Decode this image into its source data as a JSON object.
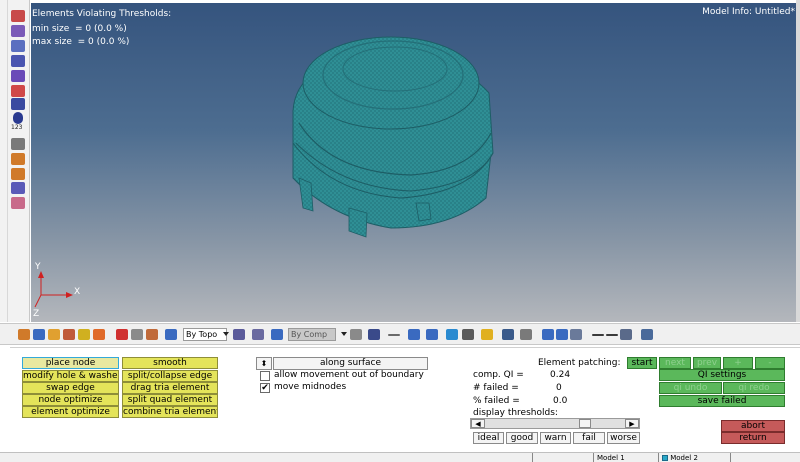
{
  "viewport": {
    "title": "Elements Violating Thresholds:",
    "min_size": "min size  = 0 (0.0 %)",
    "max_size": "max size  = 0 (0.0 %)",
    "model_info": "Model Info: Untitled*",
    "axis_x": "X",
    "axis_y": "Y",
    "axis_z": "Z"
  },
  "toolbar": {
    "by_topo": "By Topo",
    "by_comp": "By Comp"
  },
  "left_buttons": [
    "place node",
    "modify hole & washers",
    "swap edge",
    "node optimize",
    "element optimize"
  ],
  "right_buttons": [
    "smooth",
    "split/collapse edge",
    "drag tria element",
    "split quad element",
    "combine tria elements"
  ],
  "middle": {
    "along_surface": "along surface",
    "allow_movement": "allow movement out of boundary",
    "move_midnodes": "move midnodes",
    "move_midnodes_checked": "✔"
  },
  "stats": {
    "patching_label": "Element patching:",
    "comp_qi_label": "comp. QI =",
    "comp_qi_value": "0.24",
    "failed_label": "# failed =",
    "failed_value": "0",
    "pct_failed_label": "% failed =",
    "pct_failed_value": "0.0",
    "display_thresholds": "display thresholds:"
  },
  "thresholds": [
    "ideal",
    "good",
    "warn",
    "fail",
    "worse"
  ],
  "nav": {
    "start": "start",
    "next": "next",
    "prev": "prev",
    "plus": "+",
    "minus": "-",
    "qi_settings": "QI settings",
    "qi_undo": "qi undo",
    "qi_redo": "qi redo",
    "save_failed": "save failed",
    "abort": "abort",
    "return": "return"
  },
  "status_tabs": [
    "Model 1",
    "Model 2"
  ],
  "colors": {
    "accent_yellow": "#e4e45a",
    "accent_green": "#5bb85b",
    "accent_red": "#c55a5a",
    "mesh": "#2e8f96"
  }
}
